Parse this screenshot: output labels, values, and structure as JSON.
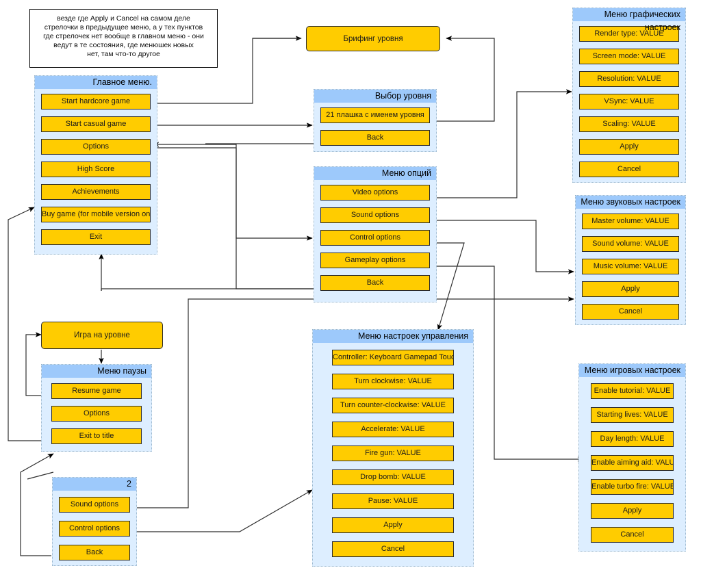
{
  "note": {
    "lines": [
      "везде где Apply и Cancel на самом деле",
      "стрелочки в предыдущее меню, а у тех пунктов",
      "где стрелочек нет вообще в главном меню - они",
      "ведут в те состояния, где менюшек новых",
      "нет, там что-то другое"
    ]
  },
  "states": {
    "level_briefing": "Брифинг уровня",
    "level_gameplay": "Игра на уровне"
  },
  "panels": {
    "main_menu": {
      "title": "Главное меню.",
      "items": [
        "Start hardcore game",
        "Start casual game",
        "Options",
        "High Score",
        "Achievements",
        "Buy game (for mobile version only)",
        "Exit"
      ]
    },
    "level_select": {
      "title": "Выбор уровня",
      "items": [
        "21 плашка с именем уровня",
        "Back"
      ]
    },
    "options_menu": {
      "title": "Меню опций",
      "items": [
        "Video options",
        "Sound options",
        "Control options",
        "Gameplay options",
        "Back"
      ]
    },
    "graphics_settings": {
      "title": "Меню графических настроек",
      "items": [
        "Render type: VALUE",
        "Screen mode: VALUE",
        "Resolution: VALUE",
        "VSync: VALUE",
        "Scaling: VALUE",
        "Apply",
        "Cancel"
      ]
    },
    "sound_settings": {
      "title": "Меню звуковых настроек",
      "items": [
        "Master volume: VALUE",
        "Sound volume: VALUE",
        "Music volume: VALUE",
        "Apply",
        "Cancel"
      ]
    },
    "control_settings": {
      "title": "Меню настроек управления",
      "items": [
        "Controller: Keyboard Gamepad Touch",
        "Turn clockwise: VALUE",
        "Turn counter-clockwise: VALUE",
        "Accelerate: VALUE",
        "Fire gun: VALUE",
        "Drop bomb: VALUE",
        "Pause: VALUE",
        "Apply",
        "Cancel"
      ]
    },
    "gameplay_settings": {
      "title": "Меню игровых настроек",
      "items": [
        "Enable tutorial: VALUE",
        "Starting lives: VALUE",
        "Day length: VALUE",
        "Enable aiming aid: VALUE",
        "Enable turbo fire: VALUE",
        "Apply",
        "Cancel"
      ]
    },
    "pause_menu": {
      "title": "Меню паузы",
      "items": [
        "Resume game",
        "Options",
        "Exit to title"
      ]
    },
    "pause_options_menu": {
      "title": "2",
      "items": [
        "Sound options",
        "Control options",
        "Back"
      ]
    }
  },
  "colors": {
    "button_fill": "#ffcc00",
    "button_border": "#2b2b2b",
    "panel_body": "#ddeeff",
    "panel_header": "#9dc9fb",
    "arrow": "#000000",
    "background": "#ffffff"
  }
}
